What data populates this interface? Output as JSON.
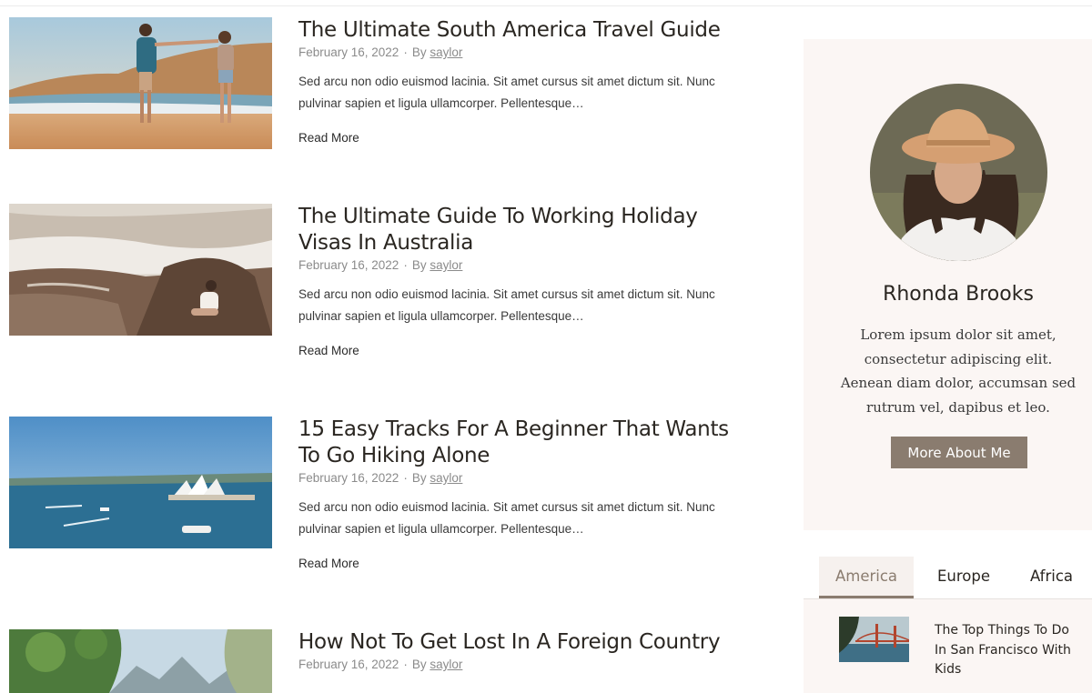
{
  "posts": [
    {
      "title": "The Ultimate South America Travel Guide",
      "date": "February 16, 2022",
      "by": "By",
      "author": "saylor",
      "excerpt": "Sed arcu non odio euismod lacinia. Sit amet cursus sit amet dictum sit. Nunc pulvinar sapien et ligula ullamcorper. Pellentesque…",
      "read_more": "Read More"
    },
    {
      "title": "The Ultimate Guide To Working Holiday Visas In Australia",
      "date": "February 16, 2022",
      "by": "By",
      "author": "saylor",
      "excerpt": "Sed arcu non odio euismod lacinia. Sit amet cursus sit amet dictum sit. Nunc pulvinar sapien et ligula ullamcorper. Pellentesque…",
      "read_more": "Read More"
    },
    {
      "title": "15 Easy Tracks For A Beginner That Wants To Go Hiking Alone",
      "date": "February 16, 2022",
      "by": "By",
      "author": "saylor",
      "excerpt": "Sed arcu non odio euismod lacinia. Sit amet cursus sit amet dictum sit. Nunc pulvinar sapien et ligula ullamcorper. Pellentesque…",
      "read_more": "Read More"
    },
    {
      "title": "How Not To Get Lost In A Foreign Country",
      "date": "February 16, 2022",
      "by": "By",
      "author": "saylor"
    }
  ],
  "about": {
    "name": "Rhonda Brooks",
    "text": "Lorem ipsum dolor sit amet, consectetur adipiscing elit. Aenean diam dolor, accumsan sed rutrum vel, dapibus et leo.",
    "button": "More About Me"
  },
  "tabs": {
    "items": [
      "America",
      "Europe",
      "Africa"
    ],
    "active": "America"
  },
  "tab_posts": [
    {
      "title": "The Top Things To Do In San Francisco With Kids"
    }
  ],
  "colors": {
    "accent": "#8a7c6f",
    "sidebar_bg": "#fbf6f4",
    "heading": "#2a2621",
    "meta": "#8b8b8b"
  }
}
